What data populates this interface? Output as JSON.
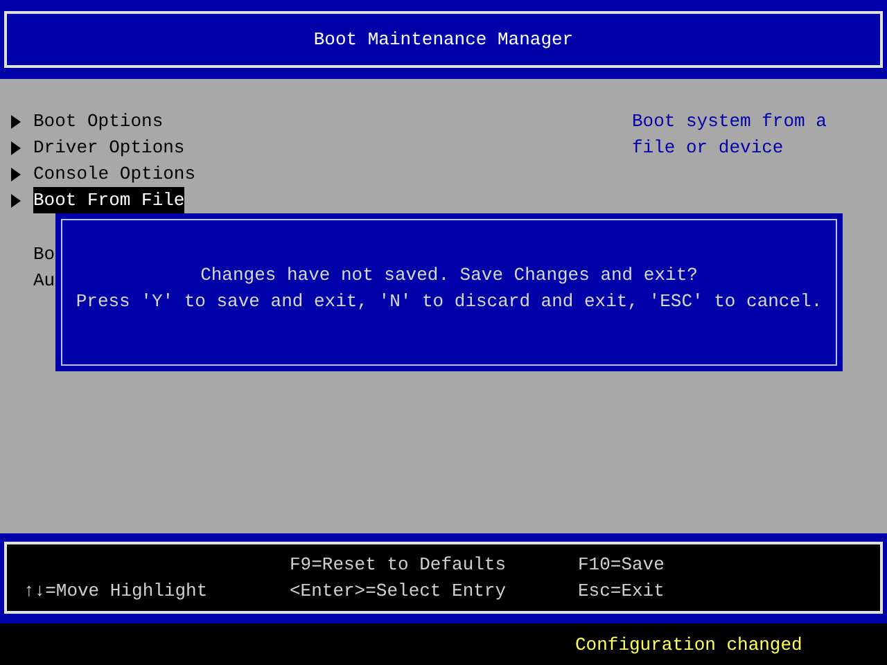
{
  "title": "Boot Maintenance Manager",
  "menu_items": [
    {
      "label": "Boot Options",
      "selected": false
    },
    {
      "label": "Driver Options",
      "selected": false
    },
    {
      "label": "Console Options",
      "selected": false
    },
    {
      "label": "Boot From File",
      "selected": true
    }
  ],
  "obscured_items": [
    "Bo",
    "Au"
  ],
  "help_text": [
    "Boot system from a",
    "file or device"
  ],
  "dialog": {
    "lines": [
      "Changes have not saved. Save Changes and exit?",
      "Press 'Y' to save and exit, 'N' to discard and exit, 'ESC' to cancel."
    ]
  },
  "footer": {
    "columns": [
      [
        "",
        "↑↓=Move Highlight"
      ],
      [
        "F9=Reset to Defaults",
        "<Enter>=Select Entry"
      ],
      [
        "F10=Save",
        "Esc=Exit"
      ]
    ]
  },
  "status": "Configuration changed"
}
